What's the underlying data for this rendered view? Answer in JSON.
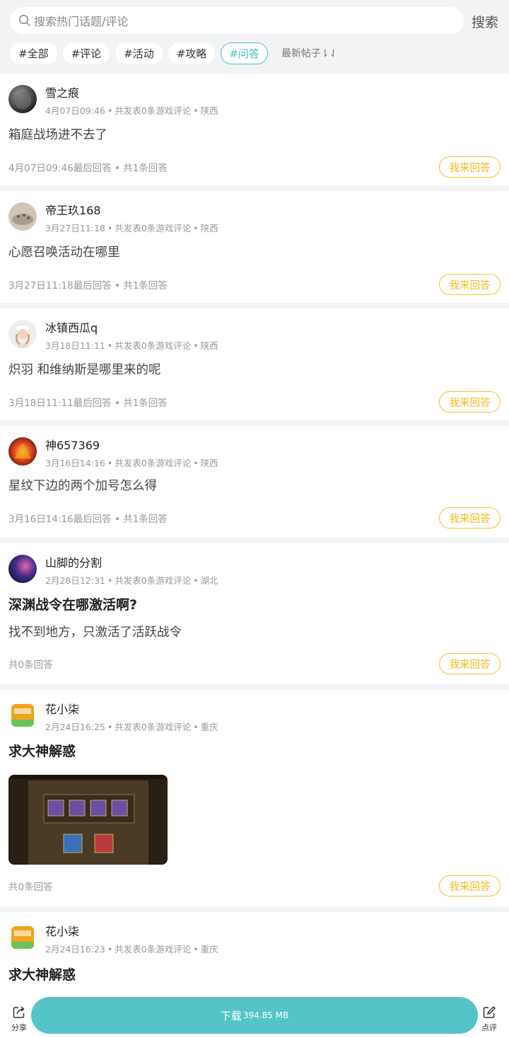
{
  "search": {
    "placeholder": "搜索热门话题/评论",
    "button": "搜索"
  },
  "tags": [
    {
      "label": "#全部",
      "active": false
    },
    {
      "label": "#评论",
      "active": false
    },
    {
      "label": "#活动",
      "active": false
    },
    {
      "label": "#攻略",
      "active": false
    },
    {
      "label": "#问答",
      "active": true
    }
  ],
  "sort_label": "最新帖子⇂⇃",
  "posts": [
    {
      "user": "雪之痕",
      "time": "4月07日09:46",
      "stats": "共发表0条游戏评论",
      "region": "陕西",
      "title": "",
      "body": "箱庭战场进不去了",
      "footer": "4月07日09:46最后回答 • 共1条回答",
      "answer": "我来回答"
    },
    {
      "user": "帝王玖168",
      "time": "3月27日11:18",
      "stats": "共发表0条游戏评论",
      "region": "陕西",
      "title": "",
      "body": "心愿召唤活动在哪里",
      "footer": "3月27日11:18最后回答 • 共1条回答",
      "answer": "我来回答"
    },
    {
      "user": "冰镇西瓜q",
      "time": "3月18日11:11",
      "stats": "共发表0条游戏评论",
      "region": "陕西",
      "title": "",
      "body": "炽羽 和维纳斯是哪里来的呢",
      "footer": "3月18日11:11最后回答 • 共1条回答",
      "answer": "我来回答"
    },
    {
      "user": "神657369",
      "time": "3月16日14:16",
      "stats": "共发表0条游戏评论",
      "region": "陕西",
      "title": "",
      "body": "星纹下边的两个加号怎么得",
      "footer": "3月16日14:16最后回答 • 共1条回答",
      "answer": "我来回答"
    },
    {
      "user": "山脚的分割",
      "time": "2月28日12:31",
      "stats": "共发表0条游戏评论",
      "region": "湖北",
      "title": "深渊战令在哪激活啊?",
      "body": "找不到地方，只激活了活跃战令",
      "footer": "共0条回答",
      "answer": "我来回答"
    },
    {
      "user": "花小柒",
      "time": "2月24日16:25",
      "stats": "共发表0条游戏评论",
      "region": "重庆",
      "title": "求大神解惑",
      "body": "",
      "footer": "共0条回答",
      "answer": "我来回答"
    },
    {
      "user": "花小柒",
      "time": "2月24日16:23",
      "stats": "共发表0条游戏评论",
      "region": "重庆",
      "title": "求大神解惑",
      "body": "",
      "footer": "",
      "answer": ""
    }
  ],
  "bottom": {
    "share": "分享",
    "download": "下载",
    "size": "394.85 MB",
    "comment": "点评"
  }
}
